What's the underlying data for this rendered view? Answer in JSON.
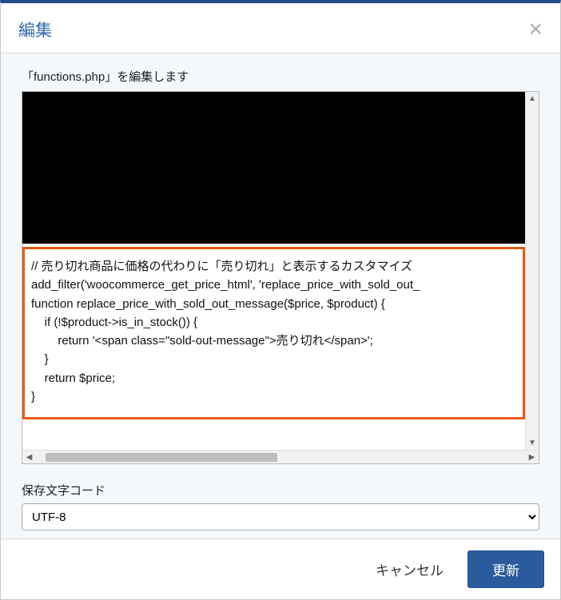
{
  "header": {
    "title": "編集",
    "close_aria": "close"
  },
  "file": {
    "label": "「functions.php」を編集します"
  },
  "code": {
    "line1": "// 売り切れ商品に価格の代わりに「売り切れ」と表示するカスタマイズ",
    "line2": "add_filter('woocommerce_get_price_html', 'replace_price_with_sold_out_",
    "line3": "",
    "line4": "function replace_price_with_sold_out_message($price, $product) {",
    "line5": "    if (!$product->is_in_stock()) {",
    "line6": "        return '<span class=\"sold-out-message\">売り切れ</span>';",
    "line7": "    }",
    "line8": "    return $price;",
    "line9": "}"
  },
  "encoding": {
    "label": "保存文字コード",
    "value": "UTF-8"
  },
  "footer": {
    "cancel": "キャンセル",
    "submit": "更新"
  }
}
